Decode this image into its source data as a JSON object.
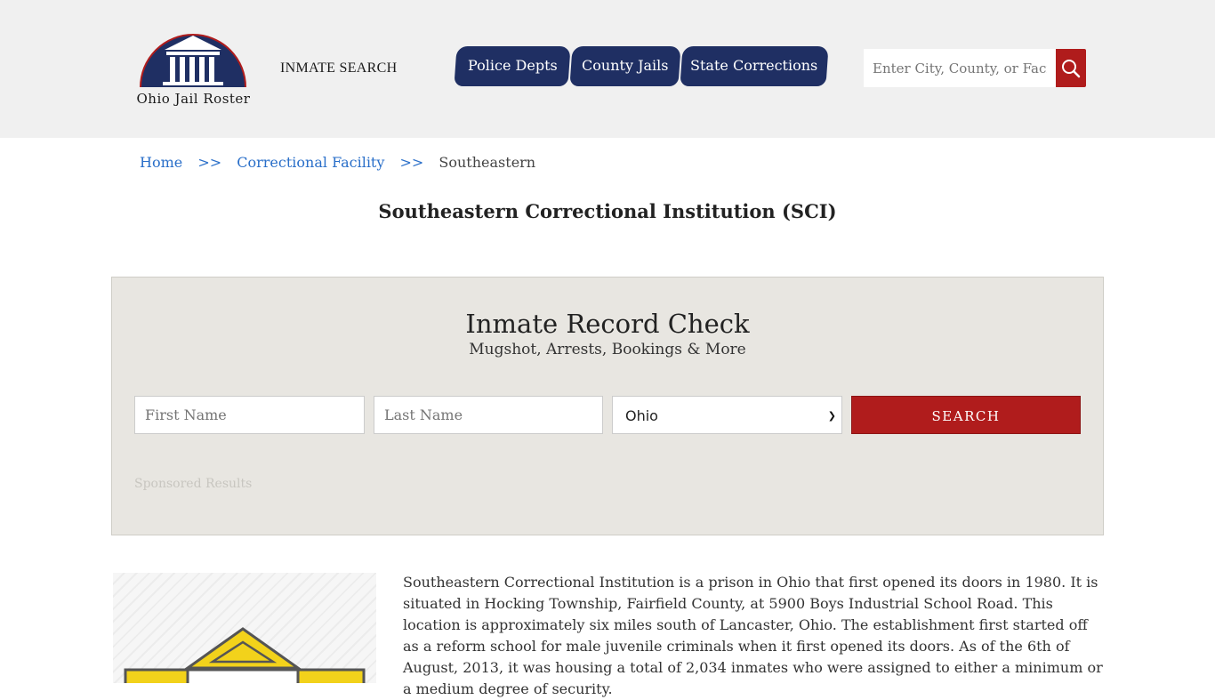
{
  "header": {
    "logo_text": "Ohio Jail Roster",
    "inmate_search_link": "INMATE SEARCH",
    "nav_tabs": [
      {
        "label": "Police Depts"
      },
      {
        "label": "County Jails"
      },
      {
        "label": "State Corrections"
      }
    ],
    "search_placeholder": "Enter City, County, or Facility"
  },
  "breadcrumb": {
    "items": [
      "Home",
      "Correctional Facility"
    ],
    "separator": ">>",
    "current": "Southeastern"
  },
  "page_title": "Southeastern Correctional Institution (SCI)",
  "record_check": {
    "title": "Inmate Record Check",
    "subtitle": "Mugshot, Arrests, Bookings & More",
    "first_name_placeholder": "First Name",
    "last_name_placeholder": "Last Name",
    "state_selected": "Ohio",
    "search_label": "SEARCH",
    "sponsored_label": "Sponsored Results"
  },
  "description": "Southeastern Correctional Institution is a prison in Ohio that first opened its doors in 1980. It is situated in Hocking Township, Fairfield County, at 5900 Boys Industrial School Road. This location is approximately six miles south of Lancaster, Ohio. The establishment first started off as a reform school for male juvenile criminals when it first opened its doors. As of the 6th of August, 2013, it was housing a total of 2,034 inmates who were assigned to either a minimum or a medium degree of security.",
  "colors": {
    "nav_bg": "#1f2f63",
    "accent_red": "#b01c1c",
    "link_blue": "#2a6fc9",
    "header_bg": "#f0f0f0",
    "box_bg": "#e8e6e1"
  }
}
